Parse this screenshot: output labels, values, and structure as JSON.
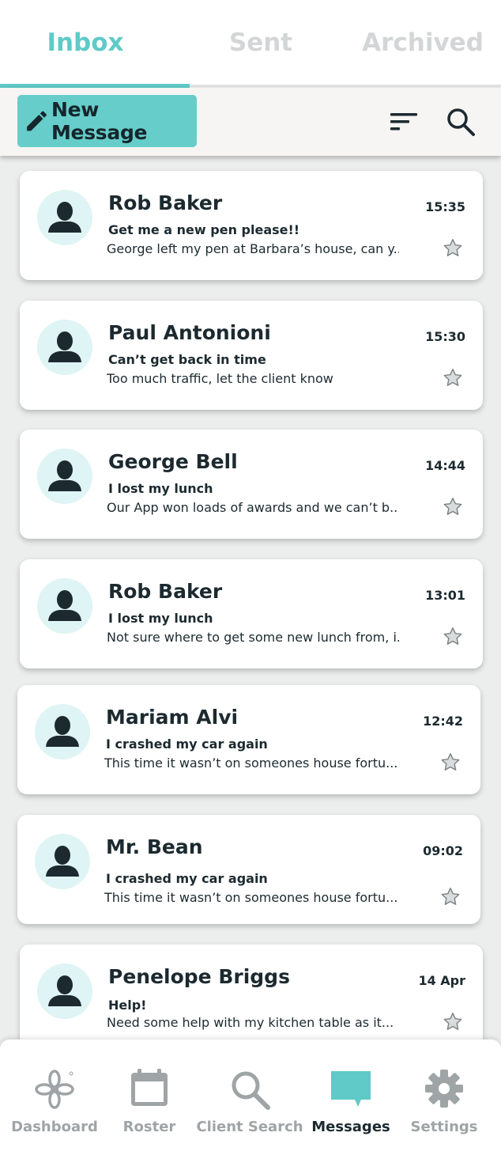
{
  "tabs": [
    {
      "label": "Inbox",
      "active": true
    },
    {
      "label": "Sent",
      "active": false
    },
    {
      "label": "Archived",
      "active": false
    }
  ],
  "toolbar": {
    "new_message_label": "New Message",
    "sort_icon": "sort-icon",
    "search_icon": "search-icon"
  },
  "messages": [
    {
      "sender": "Rob Baker",
      "time": "15:35",
      "subject": "Get me a new pen please!!",
      "preview": "George left my pen at Barbara’s house, can y...",
      "starred": false
    },
    {
      "sender": "Paul Antonioni",
      "time": "15:30",
      "subject": "Can’t get back in time",
      "preview": "Too much traffic, let the client know",
      "starred": false
    },
    {
      "sender": "George Bell",
      "time": "14:44",
      "subject": "I lost my lunch",
      "preview": "Our App won loads of awards and we can’t b....",
      "starred": false
    },
    {
      "sender": "Rob Baker",
      "time": "13:01",
      "subject": "I lost my lunch",
      "preview": "Not sure where to get some new lunch from, i...",
      "starred": false
    },
    {
      "sender": "Mariam Alvi",
      "time": "12:42",
      "subject": "I crashed my car again",
      "preview": "This time it wasn’t on someones house fortu...",
      "starred": false
    },
    {
      "sender": "Mr. Bean",
      "time": "09:02",
      "subject": "I crashed my car again",
      "preview": "This time it wasn’t on someones house fortu...",
      "starred": false
    },
    {
      "sender": "Penelope Briggs",
      "time": "14 Apr",
      "subject": "Help!",
      "preview": "Need some help with my kitchen table as it...",
      "starred": false
    }
  ],
  "nav": [
    {
      "label": "Dashboard",
      "icon": "flower-icon",
      "active": false
    },
    {
      "label": "Roster",
      "icon": "calendar-icon",
      "active": false
    },
    {
      "label": "Client Search",
      "icon": "search-icon",
      "active": false
    },
    {
      "label": "Messages",
      "icon": "chat-icon",
      "active": true
    },
    {
      "label": "Settings",
      "icon": "gear-icon",
      "active": false
    }
  ],
  "colors": {
    "accent": "#5fcac8",
    "button": "#66cdca",
    "avatar_bg": "#dff4f4",
    "text_dark": "#1c2a30",
    "inactive": "#9fa4a6"
  }
}
